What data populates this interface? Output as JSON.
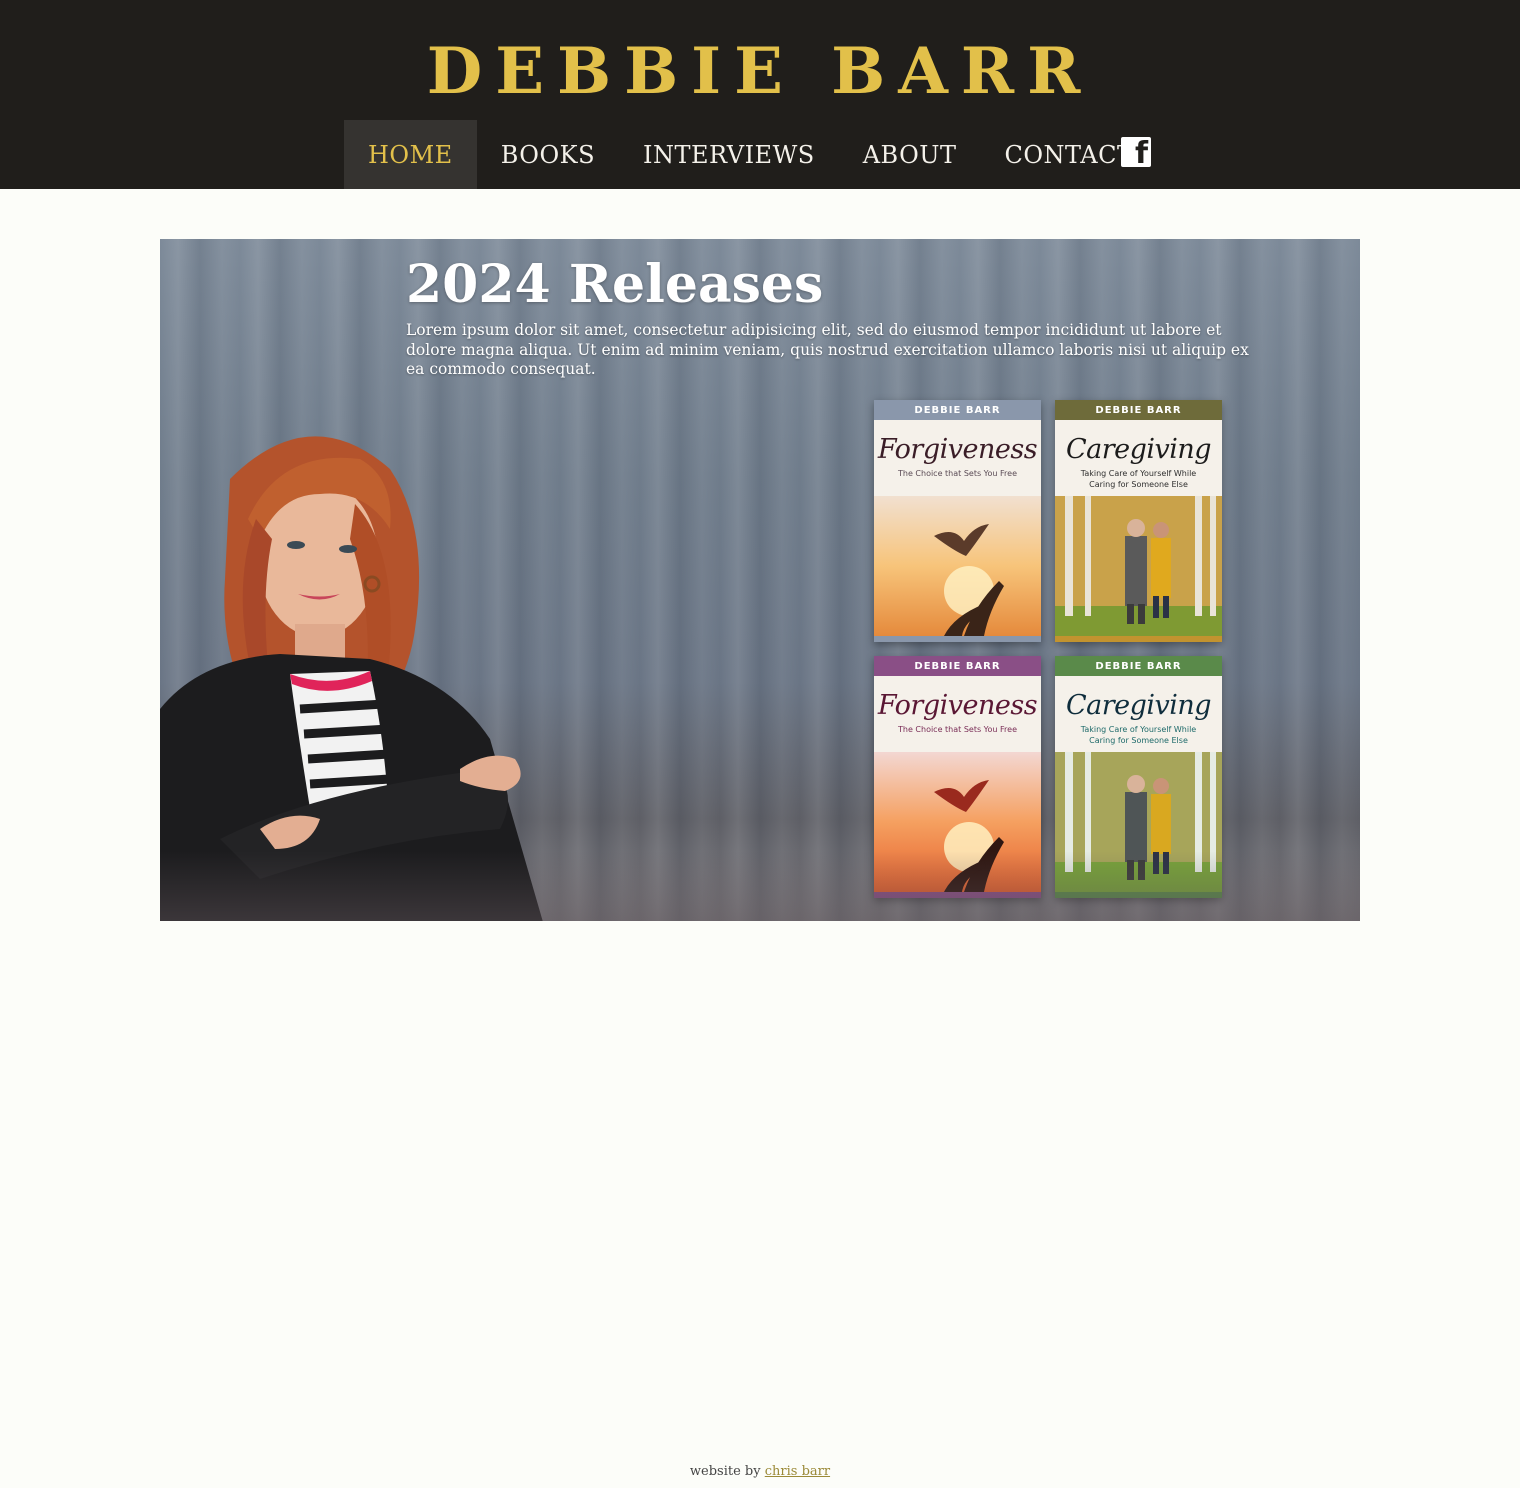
{
  "site": {
    "title": "DEBBIE BARR"
  },
  "nav": {
    "items": [
      {
        "label": "HOME",
        "active": true
      },
      {
        "label": "BOOKS"
      },
      {
        "label": "INTERVIEWS"
      },
      {
        "label": "ABOUT"
      },
      {
        "label": "CONTACT"
      }
    ],
    "social_icon": "facebook-icon"
  },
  "hero": {
    "title": "2024 Releases",
    "text": "Lorem ipsum dolor sit amet, consectetur adipisicing elit, sed do eiusmod tempor incididunt ut labore et dolore magna aliqua. Ut enim ad minim veniam, quis nostrud exercitation ullamco laboris nisi ut aliquip ex ea commodo consequat."
  },
  "books": [
    {
      "author": "DEBBIE BARR",
      "title": "Forgiveness",
      "subtitle": "The Choice that Sets You Free",
      "band_color": "#8a97ab",
      "subtitle_color": "#5a4b55",
      "title_color": "#3a1d27"
    },
    {
      "author": "DEBBIE BARR",
      "title": "Caregiving",
      "subtitle": "Taking Care of Yourself While Caring for Someone Else",
      "band_color": "#6e6b3a",
      "subtitle_color": "#2f2f2f",
      "title_color": "#1c1c1c"
    },
    {
      "author": "DEBBIE BARR",
      "title": "Forgiveness",
      "subtitle": "The Choice that Sets You Free",
      "band_color": "#8a4f86",
      "subtitle_color": "#7a2e57",
      "title_color": "#5a1734"
    },
    {
      "author": "DEBBIE BARR",
      "title": "Caregiving",
      "subtitle": "Taking Care of Yourself While Caring for Someone Else",
      "band_color": "#5a8a4a",
      "subtitle_color": "#1e6a6a",
      "title_color": "#0f2d3c"
    }
  ],
  "footer": {
    "prefix": "website by",
    "link": "chris barr"
  },
  "colors": {
    "header_bg": "#201e1b",
    "accent": "#e2c04a",
    "page_bg": "#fcfdf9"
  }
}
